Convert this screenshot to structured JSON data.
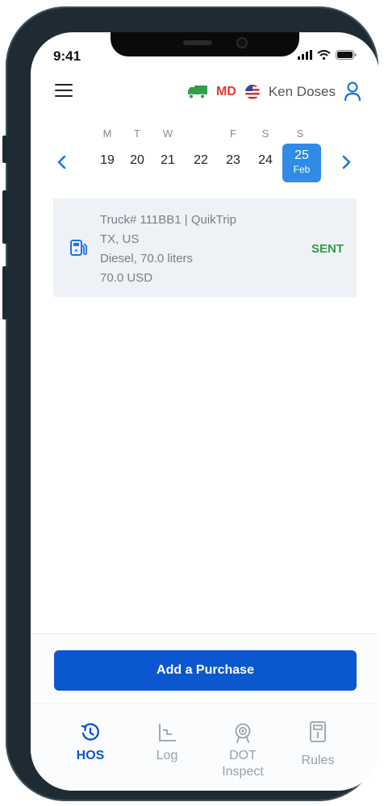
{
  "status_bar": {
    "time": "9:41"
  },
  "header": {
    "menu_icon": "hamburger-menu-icon",
    "truck_icon": "truck-icon",
    "state_code": "MD",
    "flag_icon": "us-flag-icon",
    "driver_name": "Ken Doses",
    "user_icon": "user-icon"
  },
  "calendar": {
    "weekdays": [
      "M",
      "T",
      "W",
      "",
      "F",
      "S",
      "S"
    ],
    "days": [
      "19",
      "20",
      "21",
      "22",
      "23",
      "24"
    ],
    "selected_day": "25",
    "selected_month": "Feb"
  },
  "purchase": {
    "icon": "fuel-pump-icon",
    "truck_line": "Truck#  111BB1 | QuikTrip",
    "location": "TX, US",
    "fuel": "Diesel, 70.0 liters",
    "amount": "70.0 USD",
    "status": "SENT"
  },
  "actions": {
    "add_purchase": "Add a Purchase"
  },
  "tabs": [
    {
      "label": "HOS",
      "icon": "clock-history-icon"
    },
    {
      "label": "Log",
      "icon": "log-chart-icon"
    },
    {
      "label_line1": "DOT",
      "label_line2": "Inspect",
      "icon": "inspection-badge-icon"
    },
    {
      "label": "Rules",
      "icon": "document-icon"
    }
  ],
  "colors": {
    "accent": "#0b57d0",
    "selected_day": "#2f8be6",
    "sent": "#2e9e4a",
    "state": "#e53935",
    "truck": "#2e9e4a"
  }
}
